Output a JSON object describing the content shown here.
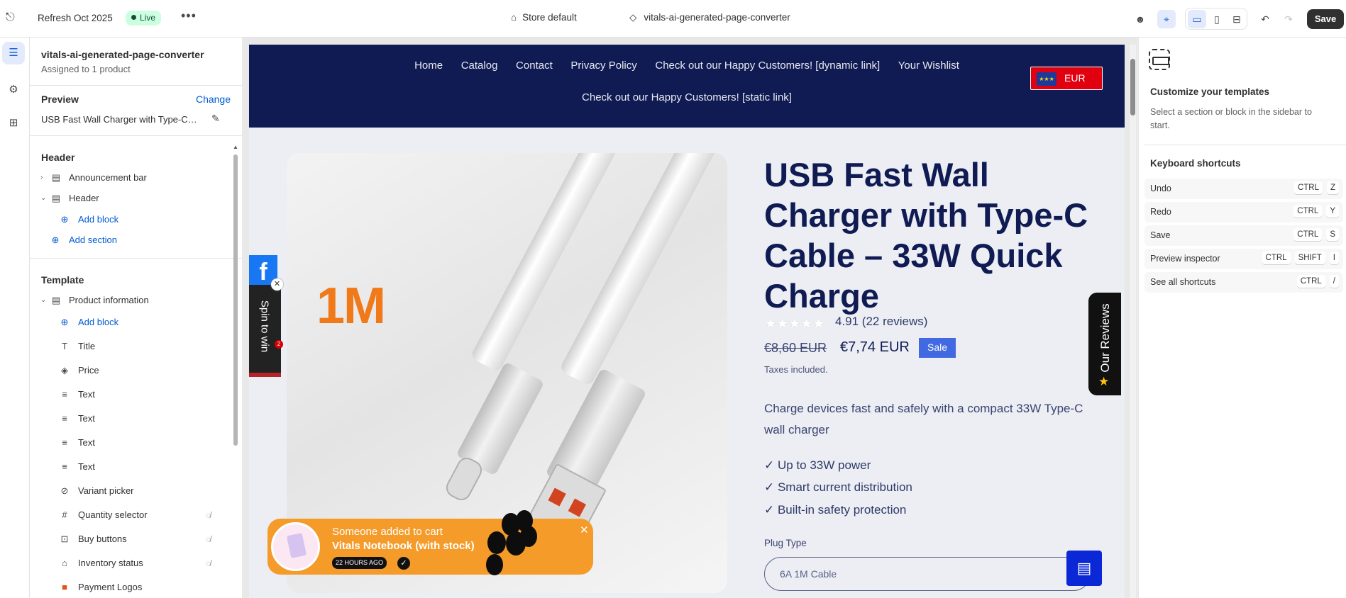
{
  "topbar": {
    "theme_name": "Refresh Oct 2025",
    "live_label": "Live",
    "more_label": "•••",
    "store_label": "Store default",
    "page_label": "vitals-ai-generated-page-converter",
    "save_label": "Save"
  },
  "sidebar": {
    "title": "vitals-ai-generated-page-converter",
    "subtitle": "Assigned to 1 product",
    "preview_label": "Preview",
    "change_label": "Change",
    "preview_value": "USB Fast Wall Charger with Type-C Cable – 33W Quick Charge",
    "header_group": "Header",
    "template_group": "Template",
    "header_items": [
      {
        "label": "Announcement bar"
      },
      {
        "label": "Header"
      },
      {
        "label": "Add block"
      },
      {
        "label": "Add section"
      }
    ],
    "template_items": [
      {
        "label": "Product information"
      },
      {
        "label": "Add block"
      },
      {
        "label": "Title"
      },
      {
        "label": "Price"
      },
      {
        "label": "Text"
      },
      {
        "label": "Text"
      },
      {
        "label": "Text"
      },
      {
        "label": "Text"
      },
      {
        "label": "Variant picker"
      },
      {
        "label": "Quantity selector"
      },
      {
        "label": "Buy buttons"
      },
      {
        "label": "Inventory status"
      },
      {
        "label": "Payment Logos"
      }
    ]
  },
  "store": {
    "nav": [
      "Home",
      "Catalog",
      "Contact",
      "Privacy Policy",
      "Check out our Happy Customers! [dynamic link]",
      "Your Wishlist"
    ],
    "nav_second": "Check out our Happy Customers! [static link]",
    "currency": "EUR",
    "image_text": "1M",
    "product_title": "USB Fast Wall Charger with Type-C Cable – 33W Quick Charge",
    "rating_text": "4.91 (22 reviews)",
    "old_price": "€8,60 EUR",
    "new_price": "€7,74 EUR",
    "sale_label": "Sale",
    "taxes": "Taxes included.",
    "description": "Charge devices fast and safely with a compact 33W Type-C wall charger",
    "bullets": [
      "✓ Up to 33W power",
      "✓ Smart current distribution",
      "✓ Built-in safety protection"
    ],
    "plug_label": "Plug Type",
    "plug_value": "6A 1M Cable",
    "reviews_tab": "Our Reviews",
    "spin_tab": "Spin to win",
    "spin_badge": "2",
    "facebook": "f",
    "toast": {
      "line1": "Someone added to cart",
      "line2": "Vitals Notebook (with stock)",
      "time": "22 HOURS AGO"
    }
  },
  "right_panel": {
    "title": "Customize your templates",
    "subtitle": "Select a section or block in the sidebar to start.",
    "shortcuts_title": "Keyboard shortcuts",
    "shortcuts": [
      {
        "label": "Undo",
        "keys": [
          "CTRL",
          "Z"
        ]
      },
      {
        "label": "Redo",
        "keys": [
          "CTRL",
          "Y"
        ]
      },
      {
        "label": "Save",
        "keys": [
          "CTRL",
          "S"
        ]
      },
      {
        "label": "Preview inspector",
        "keys": [
          "CTRL",
          "SHIFT",
          "I"
        ]
      },
      {
        "label": "See all shortcuts",
        "keys": [
          "CTRL",
          "/"
        ]
      }
    ]
  },
  "colors": {
    "accent": "#005bd3",
    "store_nav": "#0f1b52",
    "sale": "#4169e1",
    "toast": "#f49b2a"
  }
}
